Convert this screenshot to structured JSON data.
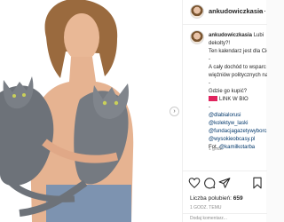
{
  "post": {
    "username": "ankudowiczkasia",
    "more_label": "…",
    "caption": {
      "username": "ankudowiczkasia",
      "line1": "Lubi",
      "line2": "dekolty?!",
      "line3": "Ten kalendarz jest dla Cie",
      "line4": "-",
      "line5": "A cały dochód to wsparc",
      "line6": "więźniów politycznych na",
      "line7": "-",
      "line8": "Gdzie go kupić?",
      "link": "LINK W BIO",
      "line9": "-",
      "tags": [
        "@dlabialorusi",
        "@kolektyw_laski",
        "@fundacjagazetywyborc",
        "@wysokieobcasy.pl"
      ],
      "foto_prefix": "Fot.",
      "foto_tag": "@kamilkotarba"
    },
    "time_ago": "1 godz.",
    "likes_prefix": "Liczba polubień:",
    "likes_count": "659",
    "date": "1 GODZ. TEMU",
    "comment_placeholder": "Dodaj komentarz..."
  },
  "icons": [
    "heart-icon",
    "comment-icon",
    "share-icon",
    "bookmark-icon",
    "chevron-right-icon",
    "more-icon"
  ],
  "colors": {
    "text": "#262626",
    "muted": "#8e8e8e",
    "tag": "#00376b",
    "border": "#efefef"
  }
}
